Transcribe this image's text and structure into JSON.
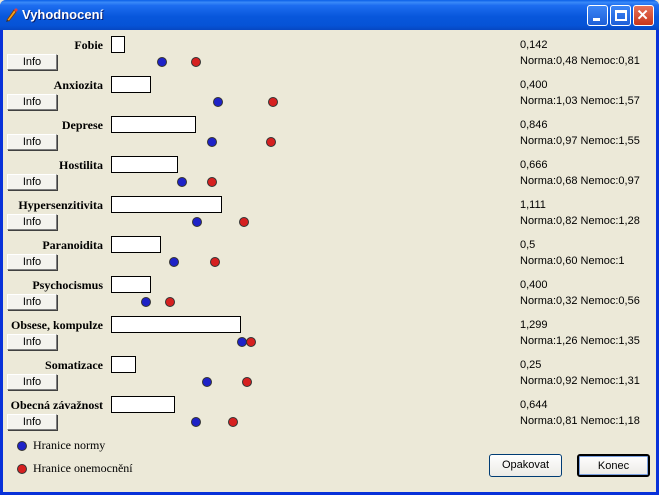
{
  "window": {
    "title": "Vyhodnocení"
  },
  "rows": [
    {
      "label": "Fobie",
      "info": "Info",
      "value": "0,142",
      "norm": "Norma:0,48  Nemoc:0,81",
      "score": 0.142,
      "norm_val": 0.48,
      "sick_val": 0.81
    },
    {
      "label": "Anxiozita",
      "info": "Info",
      "value": "0,400",
      "norm": "Norma:1,03  Nemoc:1,57",
      "score": 0.4,
      "norm_val": 1.03,
      "sick_val": 1.57
    },
    {
      "label": "Deprese",
      "info": "Info",
      "value": "0,846",
      "norm": "Norma:0,97  Nemoc:1,55",
      "score": 0.846,
      "norm_val": 0.97,
      "sick_val": 1.55
    },
    {
      "label": "Hostilita",
      "info": "Info",
      "value": "0,666",
      "norm": "Norma:0,68  Nemoc:0,97",
      "score": 0.666,
      "norm_val": 0.68,
      "sick_val": 0.97
    },
    {
      "label": "Hypersenzitivita",
      "info": "Info",
      "value": "1,111",
      "norm": "Norma:0,82  Nemoc:1,28",
      "score": 1.111,
      "norm_val": 0.82,
      "sick_val": 1.28
    },
    {
      "label": "Paranoidita",
      "info": "Info",
      "value": "0,5",
      "norm": "Norma:0,60  Nemoc:1",
      "score": 0.5,
      "norm_val": 0.6,
      "sick_val": 1.0
    },
    {
      "label": "Psychocismus",
      "info": "Info",
      "value": "0,400",
      "norm": "Norma:0,32  Nemoc:0,56",
      "score": 0.4,
      "norm_val": 0.32,
      "sick_val": 0.56
    },
    {
      "label": "Obsese, kompulze",
      "info": "Info",
      "value": "1,299",
      "norm": "Norma:1,26  Nemoc:1,35",
      "score": 1.299,
      "norm_val": 1.26,
      "sick_val": 1.35
    },
    {
      "label": "Somatizace",
      "info": "Info",
      "value": "0,25",
      "norm": "Norma:0,92  Nemoc:1,31",
      "score": 0.25,
      "norm_val": 0.92,
      "sick_val": 1.31
    },
    {
      "label": "Obecná závažnost",
      "info": "Info",
      "value": "0,644",
      "norm": "Norma:0,81  Nemoc:1,18",
      "score": 0.644,
      "norm_val": 0.81,
      "sick_val": 1.18
    }
  ],
  "legend": {
    "normal": "Hranice normy",
    "sick": "Hranice onemocnění"
  },
  "buttons": {
    "repeat": "Opakovat",
    "end": "Konec"
  },
  "colors": {
    "norm_dot": "#1e22c8",
    "sick_dot": "#d62020",
    "titlebar": "#0a5fe8"
  }
}
